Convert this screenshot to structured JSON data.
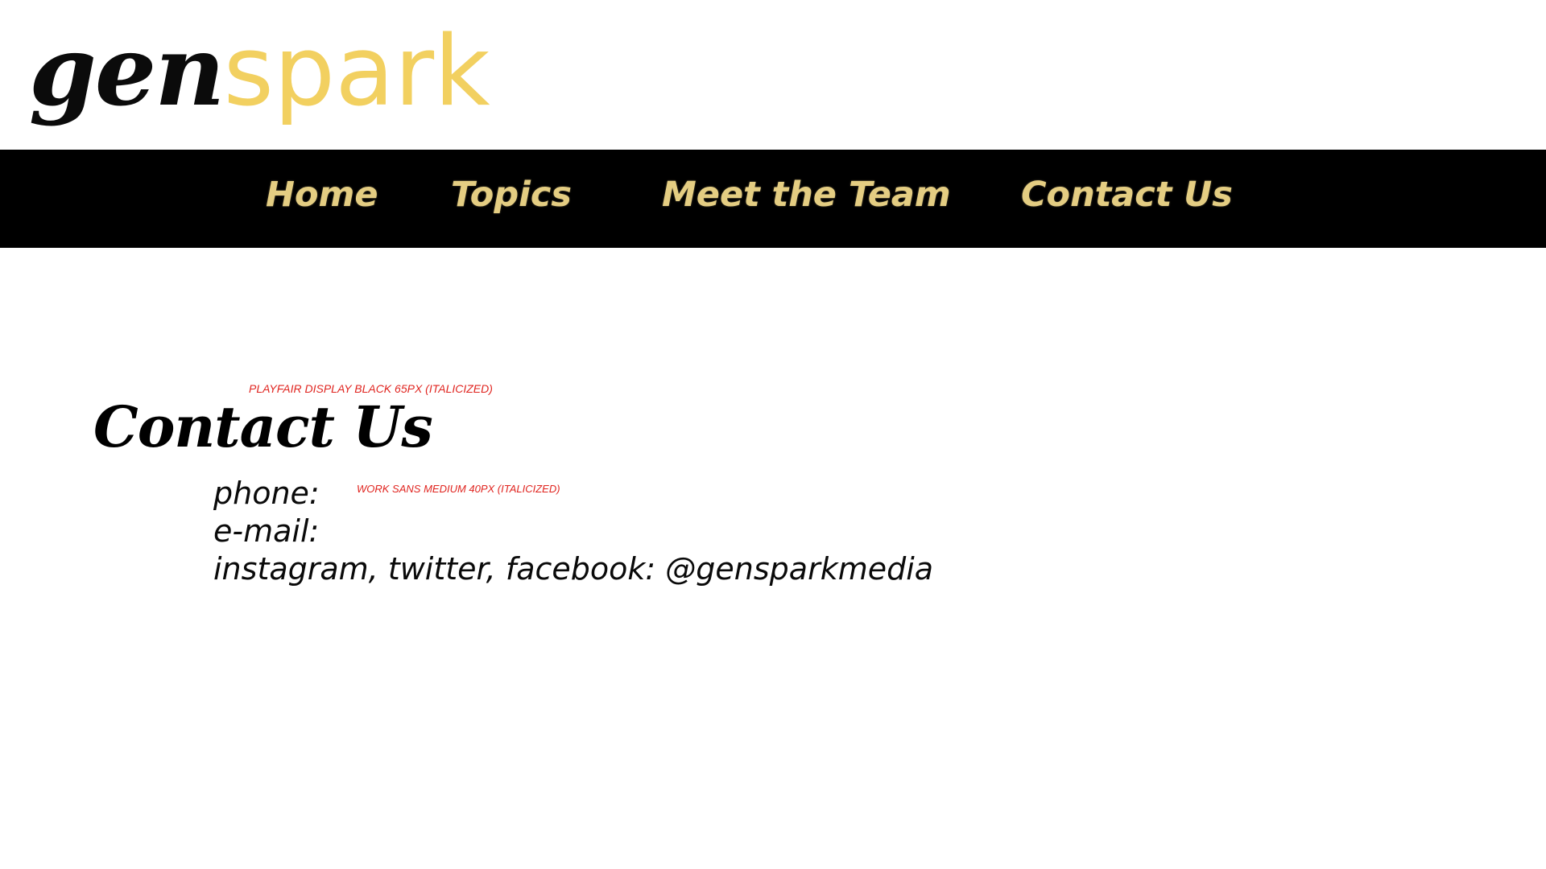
{
  "brand": {
    "logo_part1": "gen",
    "logo_part2": "spark",
    "colors": {
      "logo_dark": "#0b0b0b",
      "logo_gold": "#f2d060",
      "nav_background": "#000000",
      "nav_text": "#e4cd82",
      "annotation": "#e0241f"
    }
  },
  "nav": {
    "items": [
      {
        "label": "Home"
      },
      {
        "label": "Topics"
      },
      {
        "label": "Meet the Team"
      },
      {
        "label": "Contact Us"
      }
    ]
  },
  "main": {
    "heading_annotation": "PLAYFAIR DISPLAY BLACK 65PX (ITALICIZED)",
    "heading": "Contact Us",
    "body_annotation": "WORK SANS MEDIUM 40PX (ITALICIZED)",
    "contact_lines": [
      {
        "text": "phone:"
      },
      {
        "text": "e-mail:"
      },
      {
        "text": "instagram, twitter, facebook: @gensparkmedia"
      }
    ]
  }
}
